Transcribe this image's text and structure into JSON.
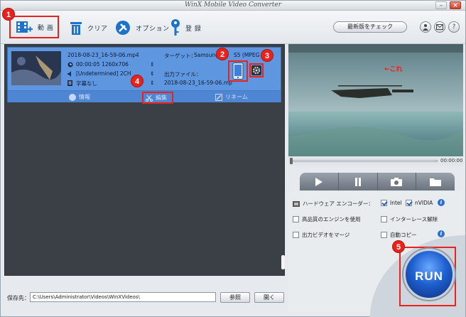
{
  "window": {
    "title": "WinX Mobile Video Converter",
    "minimize": "–",
    "close": "×"
  },
  "toolbar": {
    "video_label": "動 画",
    "clear_label": "クリア",
    "option_label": "オプション",
    "register_label": "登 録",
    "check_update": "最新版をチェック",
    "icons": [
      "user-icon",
      "mail-icon",
      "help-icon"
    ],
    "help_glyph": "?"
  },
  "file_item": {
    "filename": "2018-08-23_16-59-06.mp4",
    "duration_res": "00:00:05  1260x706",
    "audio": "[Undetermined] 2CH",
    "subtitle": "字幕なし",
    "target_label": "ターゲット：",
    "target_value": "Samsung",
    "target_suffix": "S5 (MPEG",
    "output_label": "出力ファイル：",
    "output_value": "2018-08-23_16-59-06.mp",
    "actions": {
      "info": "情報",
      "edit": "編集",
      "rename": "リネーム"
    }
  },
  "badges": [
    "1",
    "2",
    "3",
    "4",
    "5"
  ],
  "bottom": {
    "dest_label": "保存先：",
    "dest_value": "C:\\Users\\Administrator\\Videos\\WinXVideos\\",
    "browse": "参照",
    "open": "開く"
  },
  "preview": {
    "time": "00:00:00",
    "overlay_text": "←これ"
  },
  "options": {
    "hw_label": "ハードウェア エンコーダー：",
    "intel": "Intel",
    "nvidia": "nVIDIA",
    "hq_engine": "高品質のエンジンを使用",
    "deinterlace": "インターレース解除",
    "merge": "出力ビデオをマージ",
    "autocopy": "自動コピー",
    "intel_checked": true,
    "nvidia_checked": true
  },
  "run_label": "RUN",
  "colors": {
    "accent_red": "#e8231e",
    "item_blue": "#5f96e0",
    "run_blue": "#1e5fd0"
  }
}
